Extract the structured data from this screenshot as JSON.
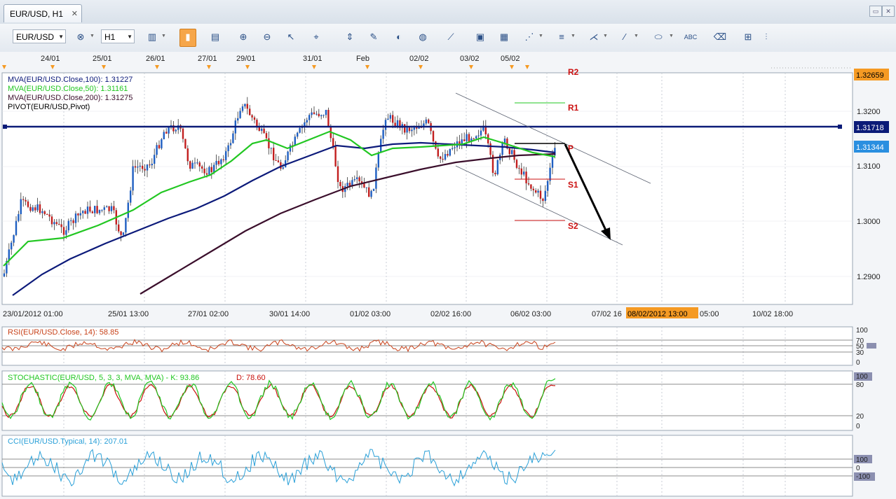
{
  "window": {
    "tab_title": "EUR/USD, H1",
    "close_glyph": "✕"
  },
  "toolbar": {
    "symbol": "EUR/USD",
    "timeframe": "H1",
    "icons": [
      "add-symbol-icon",
      "chart-type-icon",
      "candle-icon",
      "bar-icon",
      "zoom-in-icon",
      "zoom-out-icon",
      "cursor-icon",
      "crosshair-icon",
      "fit-icon",
      "edit-icon",
      "magnet-icon",
      "globe-icon",
      "ruler-icon",
      "image-icon",
      "template-icon",
      "fibonacci-icon",
      "lines-icon",
      "pitchfork-icon",
      "pencil-icon",
      "ellipse-icon",
      "text-icon",
      "eraser-icon",
      "object-tree-icon"
    ]
  },
  "main_chart": {
    "date_markers": [
      "24/01",
      "25/01",
      "26/01",
      "27/01",
      "29/01",
      "31/01",
      "Feb",
      "02/02",
      "03/02",
      "05/02"
    ],
    "legend": [
      {
        "text": "MVA(EUR/USD.Close,100): 1.31227",
        "color": "#0c1a7a"
      },
      {
        "text": "MVA(EUR/USD.Close,50): 1.31161",
        "color": "#22c722"
      },
      {
        "text": "MVA(EUR/USD.Close,200): 1.31275",
        "color": "#3b0f2c"
      },
      {
        "text": "PIVOT(EUR/USD,Pivot)",
        "color": "#000000"
      }
    ],
    "price_ticks": [
      "1.3200",
      "1.3100",
      "1.3000",
      "1.2900"
    ],
    "price_boxes": [
      {
        "label": "1.32659",
        "bg": "#f59a23",
        "fg": "#000000"
      },
      {
        "label": "1.31718",
        "bg": "#0b1b78",
        "fg": "#ffffff"
      },
      {
        "label": "1.31344",
        "bg": "#2a8fe0",
        "fg": "#ffffff"
      }
    ],
    "pivot_labels": {
      "r2": "R2",
      "r1": "R1",
      "p": "P",
      "s1": "S1",
      "s2": "S2"
    },
    "time_labels": [
      "23/01/2012 01:00",
      "25/01 13:00",
      "27/01 02:00",
      "30/01 14:00",
      "01/02 03:00",
      "02/02 16:00",
      "06/02 03:00",
      "07/02 16",
      "05:00",
      "10/02 18:00"
    ],
    "crosshair_time": "08/02/2012 13:00"
  },
  "rsi": {
    "label": "RSI(EUR/USD.Close, 14): 58.85",
    "color": "#c8421a",
    "ticks": [
      "100",
      "70",
      "50",
      "30",
      "0"
    ]
  },
  "stoch": {
    "label_main": "STOCHASTIC(EUR/USD, 5, 3, 3, MVA, MVA) -  K: 93.86",
    "label_d": "D: 78.60",
    "k_color": "#22c722",
    "d_color": "#c8120c",
    "ticks": [
      "100",
      "80",
      "20",
      "0"
    ]
  },
  "cci": {
    "label": "CCI(EUR/USD.Typical, 14): 207.01",
    "color": "#2aa0d8",
    "ticks": [
      "100",
      "0",
      "-100"
    ]
  }
}
